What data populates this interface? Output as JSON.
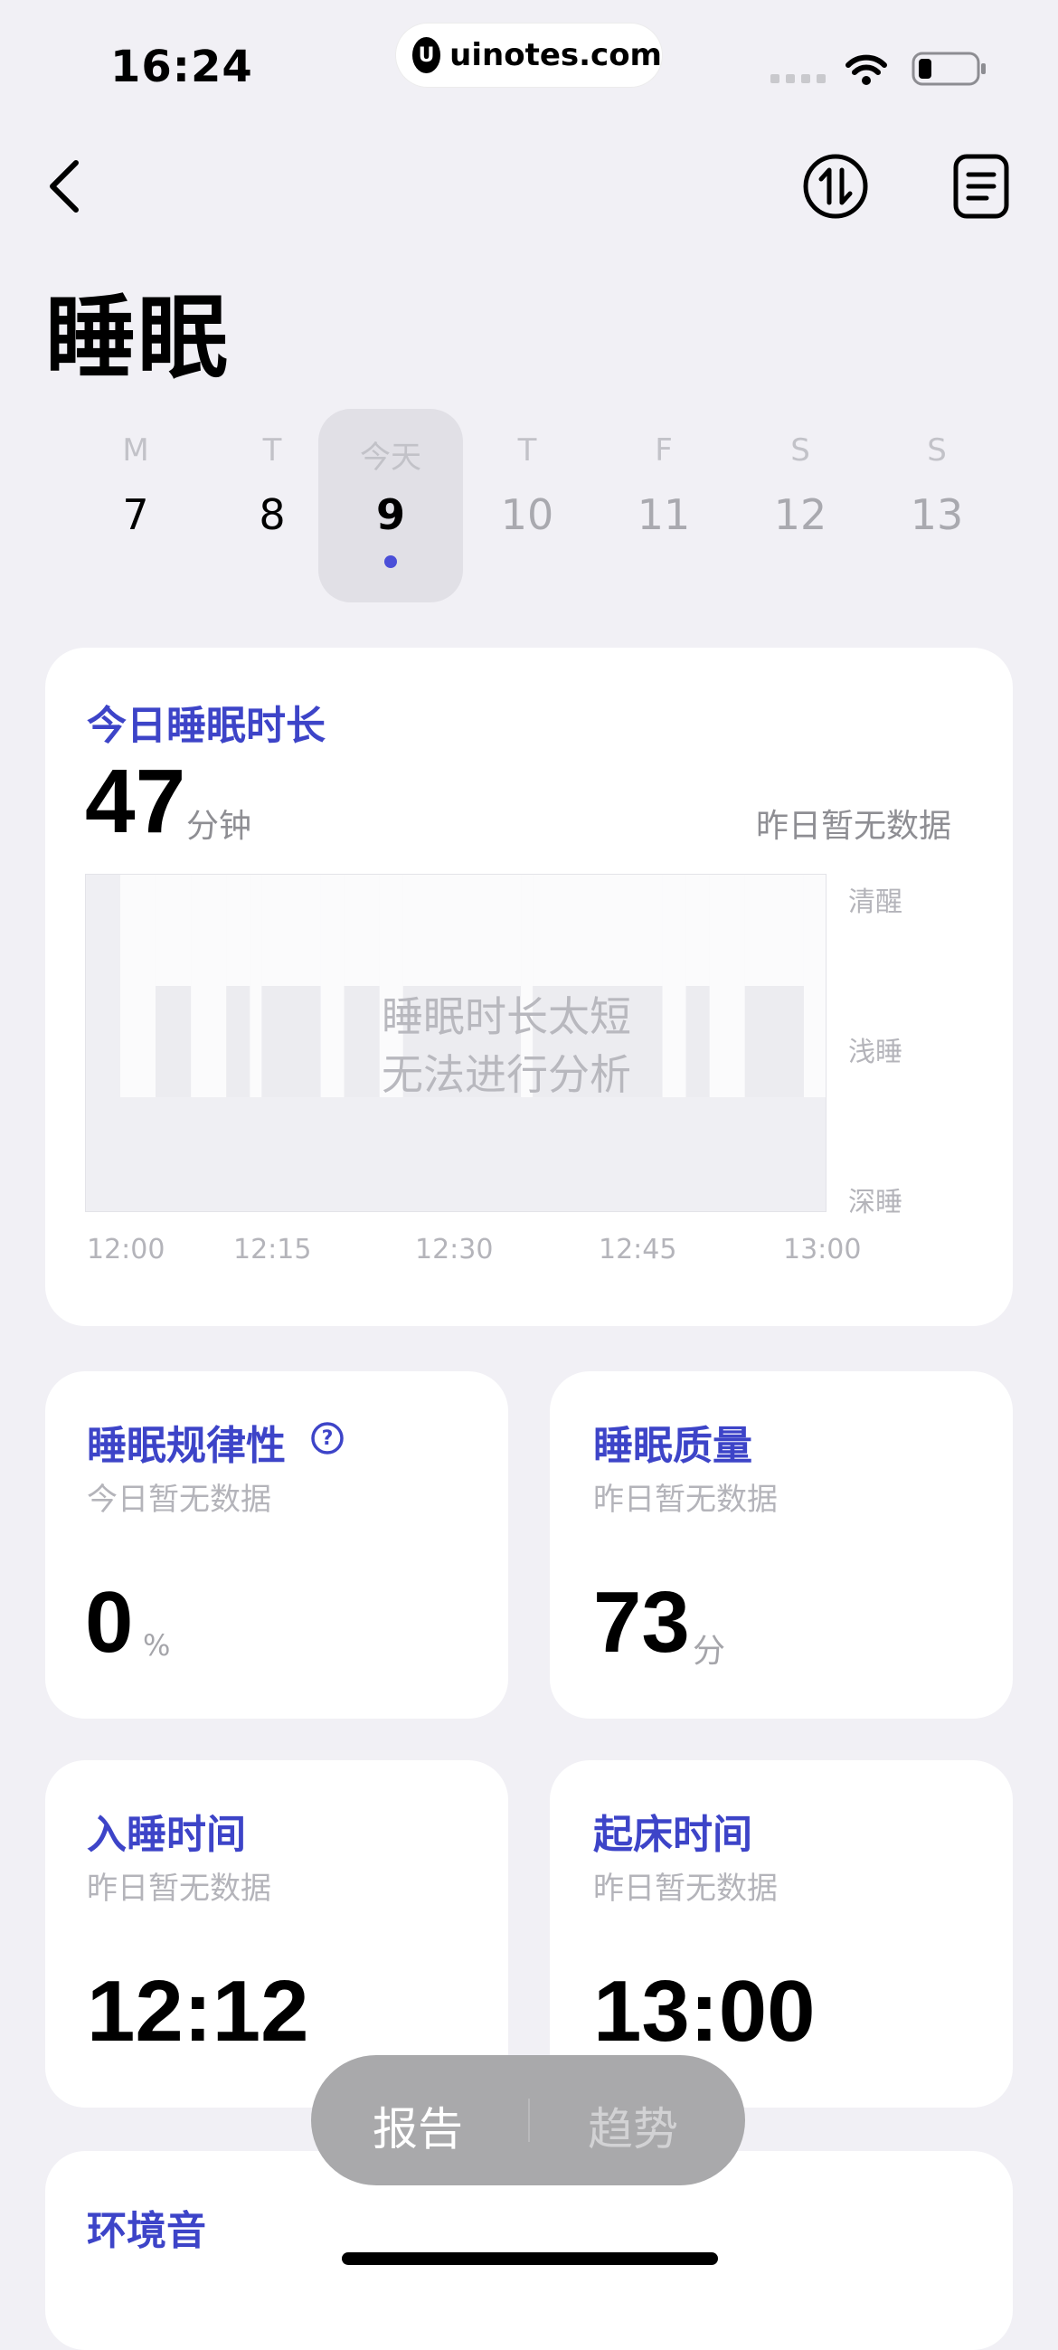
{
  "status_bar": {
    "time": "16:24",
    "url": "uinotes.com",
    "signal_icon": "cellular-signal-icon",
    "wifi_icon": "wifi-icon",
    "battery_icon": "battery-icon"
  },
  "nav": {
    "back_icon": "chevron-left-icon",
    "swap_icon": "sort-arrows-icon",
    "report_icon": "document-list-icon"
  },
  "page_title": "睡眠",
  "dates": [
    {
      "weekday": "M",
      "day": "7"
    },
    {
      "weekday": "T",
      "day": "8"
    },
    {
      "weekday": "今天",
      "day": "9",
      "selected": true
    },
    {
      "weekday": "T",
      "day": "10"
    },
    {
      "weekday": "F",
      "day": "11"
    },
    {
      "weekday": "S",
      "day": "12"
    },
    {
      "weekday": "S",
      "day": "13"
    }
  ],
  "duration_card": {
    "title": "今日睡眠时长",
    "value": "47",
    "unit": "分钟",
    "compare": "昨日暂无数据",
    "overlay_line1": "睡眠时长太短",
    "overlay_line2": "无法进行分析"
  },
  "chart_data": {
    "type": "area",
    "y_levels": [
      "清醒",
      "浅睡",
      "深睡"
    ],
    "x_ticks": [
      "12:00",
      "12:15",
      "12:30",
      "12:45",
      "13:00"
    ],
    "x_range": [
      "12:00",
      "13:00"
    ],
    "segments": [
      {
        "start": "12:00",
        "end": "12:03",
        "stage": "清醒"
      },
      {
        "start": "12:03",
        "end": "12:06",
        "stage": "浅睡"
      },
      {
        "start": "12:06",
        "end": "12:09",
        "stage": "清醒"
      },
      {
        "start": "12:09",
        "end": "12:11",
        "stage": "浅睡"
      },
      {
        "start": "12:11",
        "end": "12:12",
        "stage": "清醒"
      },
      {
        "start": "12:12",
        "end": "12:17",
        "stage": "浅睡"
      },
      {
        "start": "12:17",
        "end": "12:19",
        "stage": "清醒"
      },
      {
        "start": "12:19",
        "end": "12:22",
        "stage": "浅睡"
      },
      {
        "start": "12:22",
        "end": "12:24",
        "stage": "清醒"
      },
      {
        "start": "12:24",
        "end": "12:34",
        "stage": "浅睡"
      },
      {
        "start": "12:34",
        "end": "12:35",
        "stage": "清醒"
      },
      {
        "start": "12:35",
        "end": "12:46",
        "stage": "浅睡"
      },
      {
        "start": "12:46",
        "end": "12:48",
        "stage": "清醒"
      },
      {
        "start": "12:48",
        "end": "12:50",
        "stage": "浅睡"
      },
      {
        "start": "12:50",
        "end": "12:53",
        "stage": "清醒"
      },
      {
        "start": "12:53",
        "end": "12:58",
        "stage": "浅睡"
      },
      {
        "start": "12:58",
        "end": "13:00",
        "stage": "清醒"
      }
    ],
    "grid": "vertical dashed"
  },
  "regularity_card": {
    "title": "睡眠规律性",
    "help_icon": "question-circle-icon",
    "sub": "今日暂无数据",
    "value": "0",
    "unit": "%"
  },
  "quality_card": {
    "title": "睡眠质量",
    "sub": "昨日暂无数据",
    "value": "73",
    "unit": "分"
  },
  "sleep_time_card": {
    "title": "入睡时间",
    "sub": "昨日暂无数据",
    "value": "12:12"
  },
  "wake_time_card": {
    "title": "起床时间",
    "sub": "昨日暂无数据",
    "value": "13:00"
  },
  "ambient_card": {
    "title": "环境音"
  },
  "bottom_tabs": {
    "report": "报告",
    "trend": "趋势"
  },
  "colors": {
    "accent": "#3d44c8",
    "background": "#f1f0f5",
    "card": "#ffffff"
  }
}
